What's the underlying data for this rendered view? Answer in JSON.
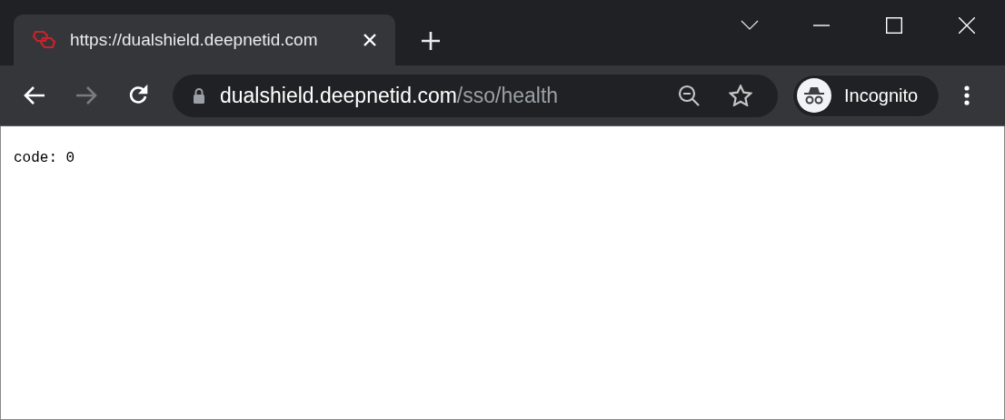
{
  "tab": {
    "title": "https://dualshield.deepnetid.com",
    "selected": true
  },
  "toolbar": {
    "back": {
      "disabled": false
    },
    "forward": {
      "disabled": true
    }
  },
  "address": {
    "host": "dualshield.deepnetid.com",
    "path": "/sso/health"
  },
  "profile": {
    "label": "Incognito"
  },
  "page": {
    "text": "code: 0"
  }
}
